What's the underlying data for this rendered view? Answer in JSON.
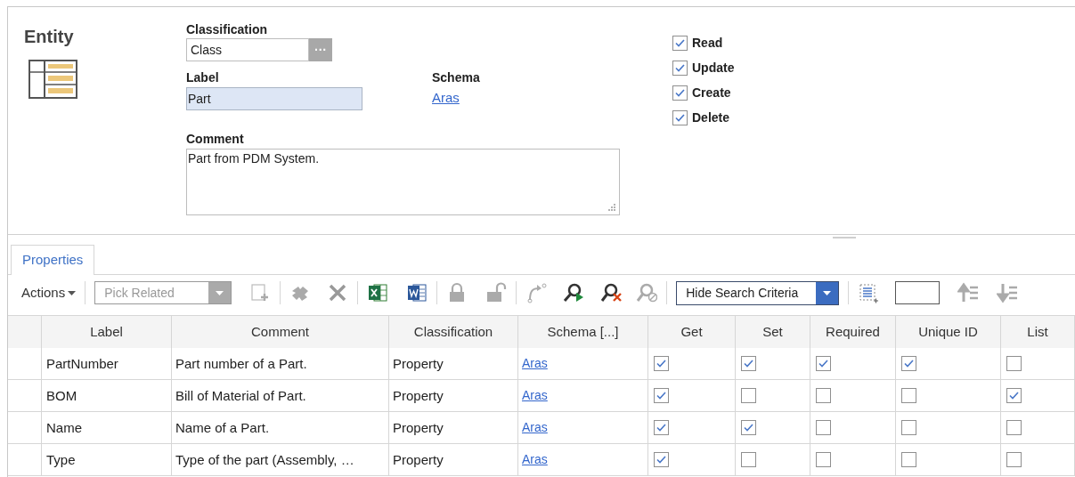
{
  "entity": {
    "title": "Entity"
  },
  "classification": {
    "label": "Classification",
    "value": "Class",
    "button": "···"
  },
  "label_field": {
    "label": "Label",
    "value": "Part"
  },
  "schema": {
    "label": "Schema",
    "link": "Aras"
  },
  "comment": {
    "label": "Comment",
    "value": "Part from PDM System."
  },
  "permissions": [
    {
      "label": "Read",
      "checked": true
    },
    {
      "label": "Update",
      "checked": true
    },
    {
      "label": "Create",
      "checked": true
    },
    {
      "label": "Delete",
      "checked": true
    }
  ],
  "tabs": [
    {
      "label": "Properties",
      "selected": true
    }
  ],
  "toolbar": {
    "actions": "Actions",
    "pick_related": {
      "placeholder": "Pick Related"
    },
    "search_mode": "Hide Search Criteria"
  },
  "table": {
    "columns": [
      "Label",
      "Comment",
      "Classification",
      "Schema [...]",
      "Get",
      "Set",
      "Required",
      "Unique ID",
      "List"
    ],
    "rows": [
      {
        "label": "PartNumber",
        "comment": "Part number of a Part.",
        "classification": "Property",
        "schema": "Aras",
        "get": true,
        "set": true,
        "required": true,
        "unique_id": true,
        "list": false
      },
      {
        "label": "BOM",
        "comment": "Bill of Material of Part.",
        "classification": "Property",
        "schema": "Aras",
        "get": true,
        "set": false,
        "required": false,
        "unique_id": false,
        "list": true
      },
      {
        "label": "Name",
        "comment": "Name of a Part.",
        "classification": "Property",
        "schema": "Aras",
        "get": true,
        "set": true,
        "required": false,
        "unique_id": false,
        "list": false
      },
      {
        "label": "Type",
        "comment": "Type of the part (Assembly, …",
        "classification": "Property",
        "schema": "Aras",
        "get": true,
        "set": false,
        "required": false,
        "unique_id": false,
        "list": false
      }
    ]
  }
}
